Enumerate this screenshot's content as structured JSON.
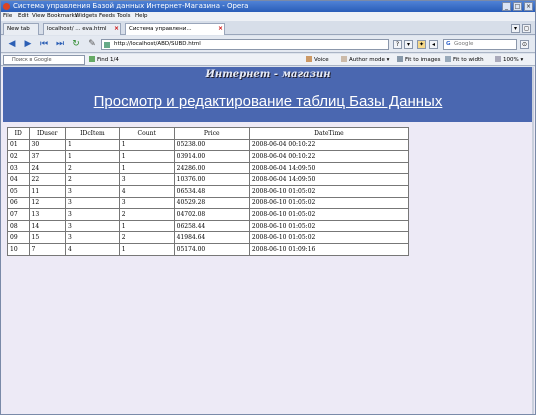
{
  "window": {
    "title": "Система управления Базой данных Интернет-Магазина - Opera"
  },
  "menu": [
    "File",
    "Edit",
    "View",
    "Bookmarks",
    "Widgets",
    "Feeds",
    "Tools",
    "Help"
  ],
  "tabs": [
    {
      "label": "New tab"
    },
    {
      "label": "localhost/ ... eva.html"
    },
    {
      "label": "Система управлени..."
    }
  ],
  "address": {
    "url": "http://localhost/ABD/SUBD.html",
    "search_placeholder": "Google"
  },
  "findbar": {
    "find_placeholder": "Поиск в Google",
    "find_label": "Find",
    "voice": "Voice",
    "author_mode": "Author mode",
    "images": "Fit to images",
    "width": "Fit to width",
    "zoom": "100%"
  },
  "page": {
    "shop_name": "Интернет - магазин",
    "heading": "Просмотр и редактирование таблиц Базы Данных",
    "table": {
      "headers": [
        "ID",
        "IDuser",
        "IDcItem",
        "Count",
        "Price",
        "DateTime"
      ],
      "rows": [
        [
          "01",
          "30",
          "1",
          "1",
          "05238.00",
          "2008-06-04 00:10:22"
        ],
        [
          "02",
          "37",
          "1",
          "1",
          "03914.00",
          "2008-06-04 00:10:22"
        ],
        [
          "03",
          "24",
          "2",
          "1",
          "24286.00",
          "2008-06-04 14:09:50"
        ],
        [
          "04",
          "22",
          "2",
          "3",
          "10376.00",
          "2008-06-04 14:09:50"
        ],
        [
          "05",
          "11",
          "3",
          "4",
          "06534.48",
          "2008-06-10 01:05:02"
        ],
        [
          "06",
          "12",
          "3",
          "3",
          "40529.28",
          "2008-06-10 01:05:02"
        ],
        [
          "07",
          "13",
          "3",
          "2",
          "04702.08",
          "2008-06-10 01:05:02"
        ],
        [
          "08",
          "14",
          "3",
          "1",
          "06258.44",
          "2008-06-10 01:05:02"
        ],
        [
          "09",
          "15",
          "3",
          "2",
          "41984.64",
          "2008-06-10 01:05:02"
        ],
        [
          "10",
          "7",
          "4",
          "1",
          "05174.00",
          "2008-06-10 01:09:16"
        ]
      ]
    }
  }
}
